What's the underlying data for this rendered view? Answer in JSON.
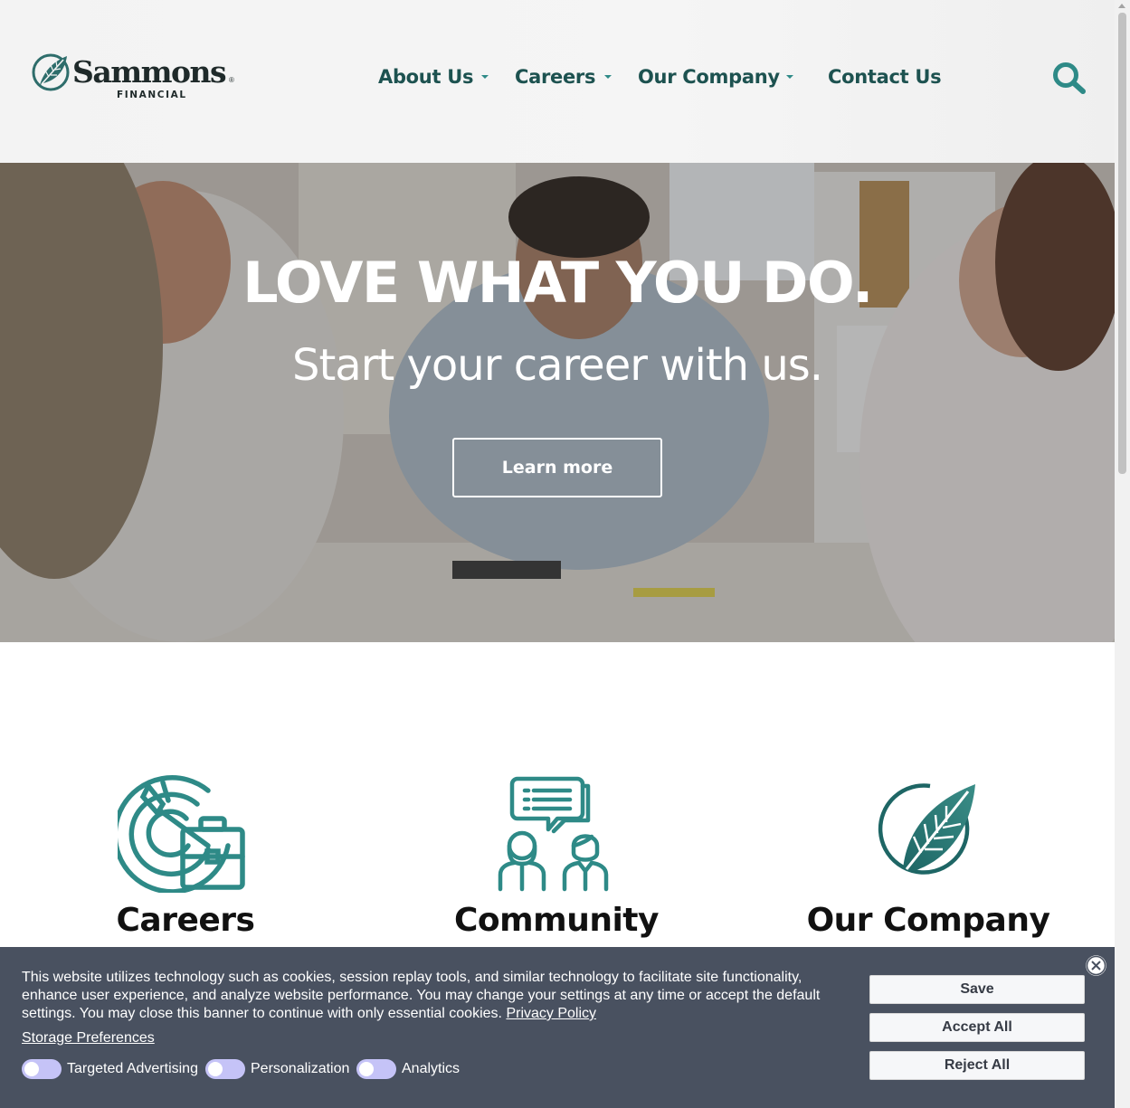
{
  "header": {
    "logo": {
      "wordmark": "Sammons",
      "registered": "®",
      "subline": "FINANCIAL"
    },
    "nav": [
      {
        "label": "About Us",
        "has_dropdown": true
      },
      {
        "label": "Careers",
        "has_dropdown": true
      },
      {
        "label": "Our Company",
        "has_dropdown": true
      },
      {
        "label": "Contact Us",
        "has_dropdown": false
      }
    ],
    "search_icon": "search-icon"
  },
  "hero": {
    "title": "LOVE WHAT YOU DO.",
    "subtitle": "Start your career with us.",
    "button_label": "Learn more"
  },
  "features": [
    {
      "title": "Careers",
      "icon": "target-briefcase-icon"
    },
    {
      "title": "Community",
      "icon": "people-chat-icon"
    },
    {
      "title": "Our Company",
      "icon": "leaf-logo-icon"
    }
  ],
  "cookie_banner": {
    "text": "This website utilizes technology such as cookies, session replay tools, and similar technology to facilitate site functionality, enhance user experience, and analyze website performance. You may change your settings at any time or accept the default settings. You may close this banner to continue with only essential cookies.",
    "privacy_link": "Privacy Policy",
    "storage_link": "Storage Preferences",
    "toggles": [
      {
        "label": "Targeted Advertising",
        "on": false
      },
      {
        "label": "Personalization",
        "on": false
      },
      {
        "label": "Analytics",
        "on": false
      }
    ],
    "buttons": {
      "save": "Save",
      "accept_all": "Accept All",
      "reject_all": "Reject All"
    },
    "close_icon": "close-icon"
  },
  "colors": {
    "brand_teal": "#2e8a87",
    "nav_text": "#1d5250",
    "banner_bg": "#495160",
    "toggle_bg": "#c5c3f7"
  }
}
